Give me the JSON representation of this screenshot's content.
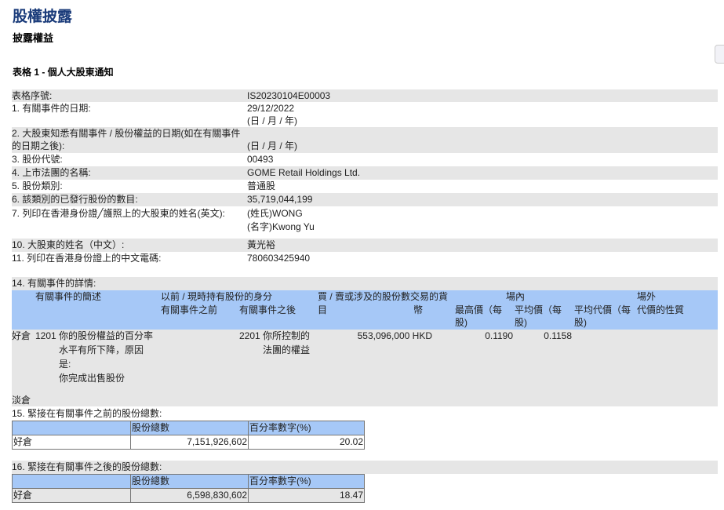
{
  "page": {
    "title": "股權披露",
    "subtitle": "披露權益",
    "form_title": "表格 1 - 個人大股東通知"
  },
  "info": [
    {
      "label": "表格序號:",
      "value": "IS20230104E00003"
    },
    {
      "label": "1. 有關事件的日期:",
      "value": "29/12/2022",
      "value2": "(日 / 月 / 年)"
    },
    {
      "label": "2. 大股東知悉有關事件 / 股份權益的日期(如在有關事件",
      "label2": "的日期之後):",
      "value2": "(日 / 月 / 年)"
    },
    {
      "label": "3. 股份代號:",
      "value": "00493"
    },
    {
      "label": "4. 上市法團的名稱:",
      "value": "GOME Retail Holdings Ltd."
    },
    {
      "label": "5. 股份類別:",
      "value": "普通股"
    },
    {
      "label": "6. 該類別的已發行股份的數目:",
      "value": "35,719,044,199"
    },
    {
      "label": "7. 列印在香港身份證╱護照上的大股東的姓名(英文):",
      "value": "(姓氏)WONG",
      "value2": "(名字)Kwong Yu"
    },
    {
      "label": "10. 大股東的姓名（中文）:",
      "value": "黃光裕"
    },
    {
      "label": "11. 列印在香港身份證上的中文電碼:",
      "value": "780603425940"
    }
  ],
  "event": {
    "title": "14. 有關事件的詳情:",
    "headers": {
      "desc": "有關事件的簡述",
      "capacity": "以前 / 現時持有股份的身分",
      "before": "有關事件之前",
      "after": "有關事件之後",
      "shares1": "買 / 賣或涉及的股份數交易的貨",
      "shares2": "目",
      "currency": "幣",
      "onex": "場內",
      "high1": "最高價（每",
      "high2": "股)",
      "avg1": "平均價（每",
      "avg2": "股)",
      "avgc1": "平均代價（每",
      "avgc2": "股)",
      "offex": "場外",
      "nature": "代價的性質"
    },
    "row": {
      "position": "好倉",
      "code": "1201",
      "desc": [
        "你的股份權益的百分率",
        "水平有所下降，原因",
        "是:",
        "你完成出售股份"
      ],
      "after_code": "2201",
      "after": [
        "你所控制的",
        "法團的權益"
      ],
      "shares": "553,096,000 HKD",
      "high": "0.1190",
      "avg": "0.1158"
    },
    "short": "淡倉"
  },
  "t15": {
    "title": "15. 緊接在有關事件之前的股份總數:",
    "h1": "股份總數",
    "h2": "百分率數字(%)",
    "pos": "好倉",
    "shares": "7,151,926,602",
    "pct": "20.02"
  },
  "t16": {
    "title": "16. 緊接在有關事件之後的股份總數:",
    "h1": "股份總數",
    "h2": "百分率數字(%)",
    "pos": "好倉",
    "shares": "6,598,830,602",
    "pct": "18.47"
  }
}
